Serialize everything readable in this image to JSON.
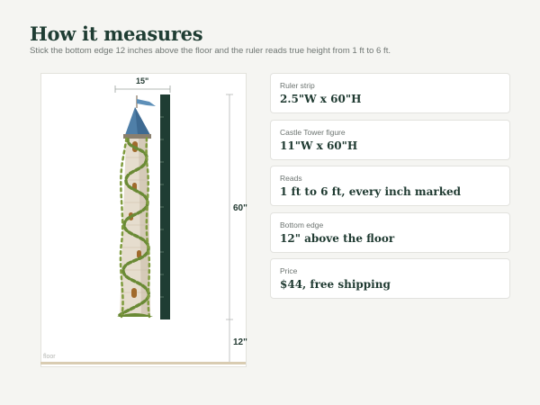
{
  "header": {
    "title": "How it measures",
    "subtitle": "Stick the bottom edge 12 inches above the floor and the ruler reads true height from 1 ft to 6 ft."
  },
  "figure": {
    "width_label": "15\"",
    "height_label": "60\"",
    "gap_label": "12\"",
    "floor_label": "floor"
  },
  "specs": [
    {
      "label": "Ruler strip",
      "value": "2.5\"W x 60\"H"
    },
    {
      "label": "Castle Tower figure",
      "value": "11\"W x 60\"H"
    },
    {
      "label": "Reads",
      "value": "1 ft to 6 ft, every inch marked"
    },
    {
      "label": "Bottom edge",
      "value": "12\" above the floor"
    },
    {
      "label": "Price",
      "value": "$44, free shipping"
    }
  ],
  "colors": {
    "accent": "#1f3d33",
    "strip": "#1f3d33",
    "floor": "#d9ccb2",
    "roof": "#4f7fa8",
    "leaves": "#7f9b3d"
  }
}
